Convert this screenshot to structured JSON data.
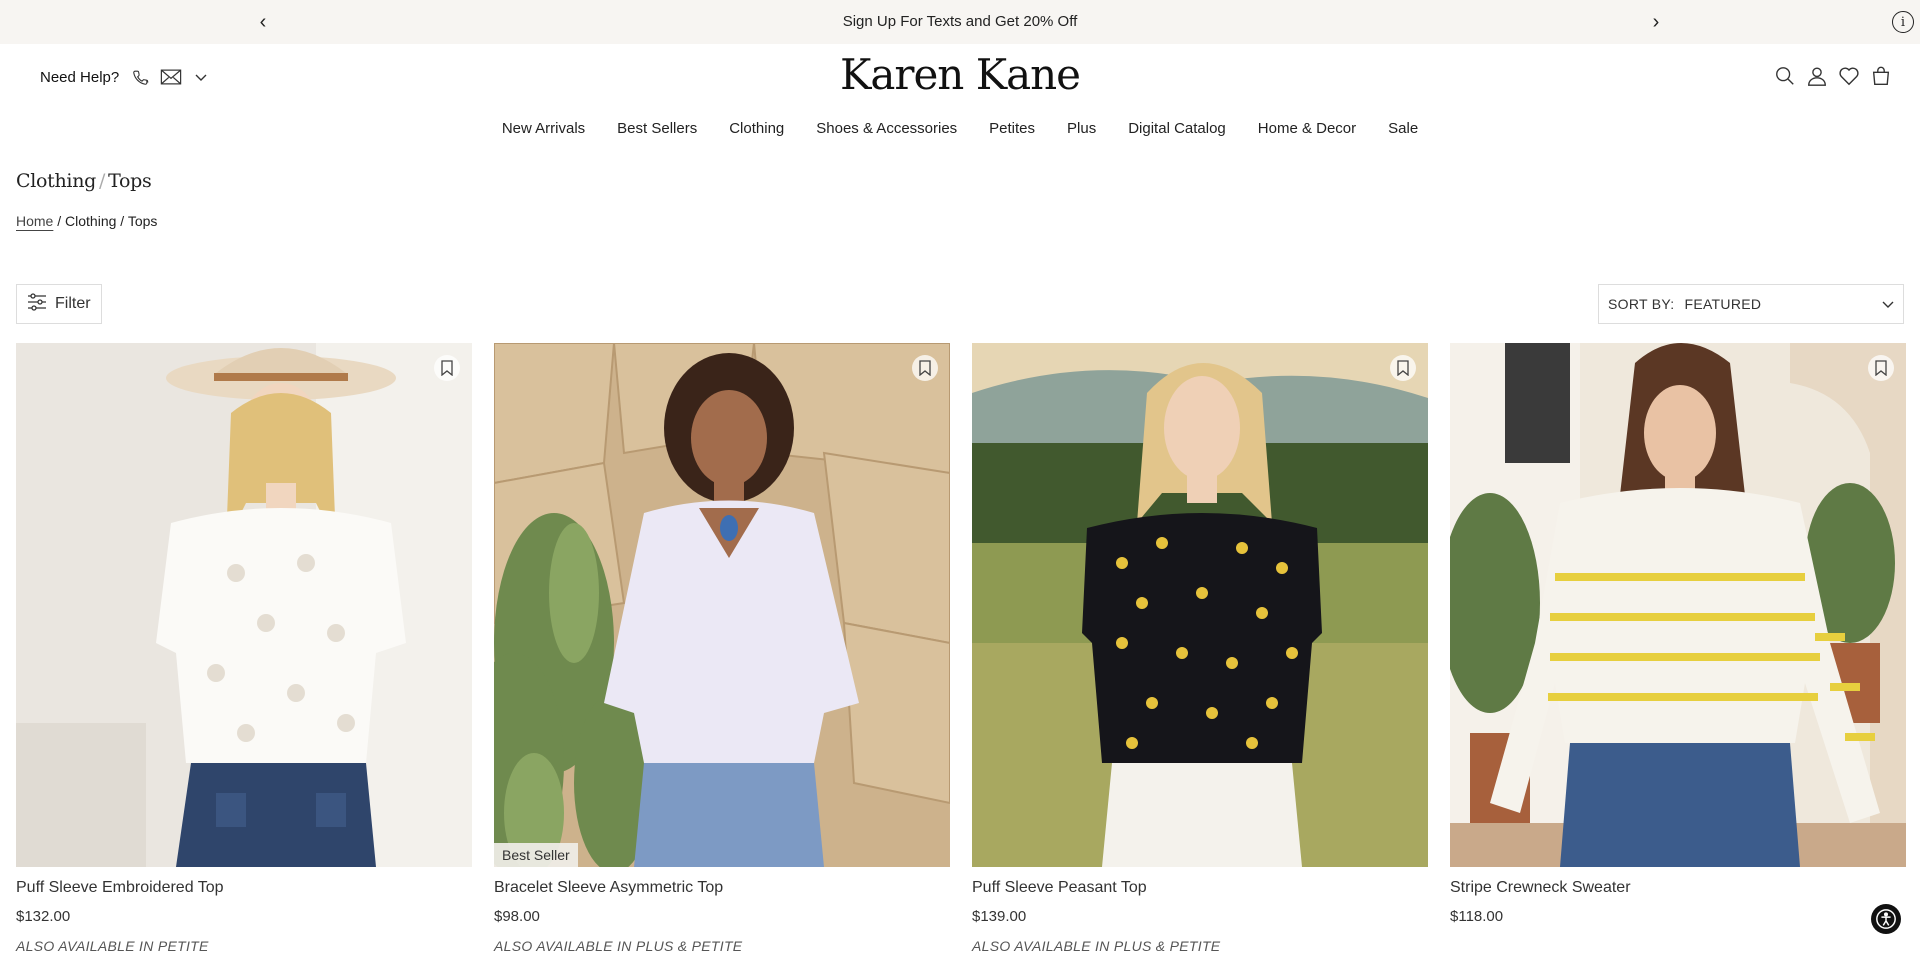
{
  "promo": {
    "text": "Sign Up For Texts and Get 20% Off",
    "prev_glyph": "‹",
    "next_glyph": "›",
    "info_glyph": "i"
  },
  "header": {
    "help_label": "Need Help?",
    "logo": "Karen Kane",
    "icons": [
      "phone-icon",
      "mail-icon",
      "chevron-down-icon",
      "search-icon",
      "account-icon",
      "heart-icon",
      "bag-icon"
    ]
  },
  "nav": [
    "New Arrivals",
    "Best Sellers",
    "Clothing",
    "Shoes & Accessories",
    "Petites",
    "Plus",
    "Digital Catalog",
    "Home & Decor",
    "Sale"
  ],
  "page": {
    "title_parent": "Clothing",
    "title_sep": "/",
    "title_current": "Tops",
    "breadcrumb": {
      "home": "Home",
      "sep": "/",
      "clothing": "Clothing",
      "tops": "Tops"
    }
  },
  "toolbar": {
    "filter_label": "Filter",
    "sort_label": "SORT BY:",
    "sort_value": "FEATURED"
  },
  "products": [
    {
      "name": "Puff Sleeve Embroidered Top",
      "price": "$132.00",
      "availability": "ALSO AVAILABLE IN PETITE",
      "badge": ""
    },
    {
      "name": "Bracelet Sleeve Asymmetric Top",
      "price": "$98.00",
      "availability": "ALSO AVAILABLE IN PLUS & PETITE",
      "badge": "Best Seller"
    },
    {
      "name": "Puff Sleeve Peasant Top",
      "price": "$139.00",
      "availability": "ALSO AVAILABLE IN PLUS & PETITE",
      "badge": ""
    },
    {
      "name": "Stripe Crewneck Sweater",
      "price": "$118.00",
      "availability": "",
      "badge": ""
    }
  ],
  "colors": {
    "promo_bg": "#f7f5f2",
    "text": "#222222",
    "border": "#dddddd"
  }
}
